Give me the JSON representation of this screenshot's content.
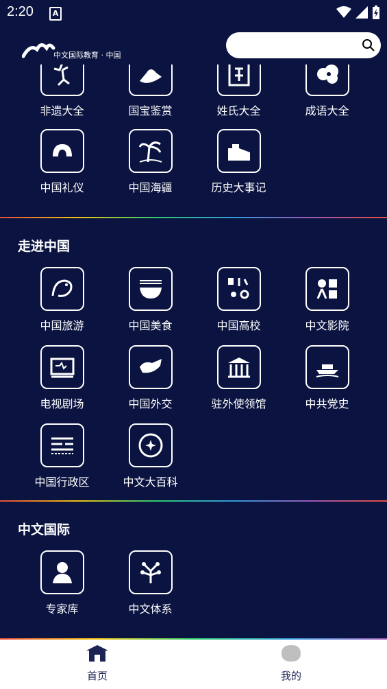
{
  "status": {
    "time": "2:20"
  },
  "header": {
    "logo_text": "中文国际教育 · 中国",
    "search_placeholder": ""
  },
  "section0": {
    "items": [
      {
        "label": "非遗大全",
        "icon": "dancer-icon"
      },
      {
        "label": "国宝鉴赏",
        "icon": "treasure-icon"
      },
      {
        "label": "姓氏大全",
        "icon": "surname-icon"
      },
      {
        "label": "成语大全",
        "icon": "cloud-icon"
      },
      {
        "label": "中国礼仪",
        "icon": "bow-icon"
      },
      {
        "label": "中国海疆",
        "icon": "palm-icon"
      },
      {
        "label": "历史大事记",
        "icon": "great-wall-icon"
      }
    ]
  },
  "section1": {
    "title": "走进中国",
    "items": [
      {
        "label": "中国旅游",
        "icon": "dragon-icon"
      },
      {
        "label": "中国美食",
        "icon": "bowl-icon"
      },
      {
        "label": "中国高校",
        "icon": "school-icon"
      },
      {
        "label": "中文影院",
        "icon": "cinema-icon"
      },
      {
        "label": "电视剧场",
        "icon": "tv-icon"
      },
      {
        "label": "中国外交",
        "icon": "handshake-icon"
      },
      {
        "label": "驻外使领馆",
        "icon": "embassy-icon"
      },
      {
        "label": "中共党史",
        "icon": "boat-icon"
      },
      {
        "label": "中国行政区",
        "icon": "map-icon"
      },
      {
        "label": "中文大百科",
        "icon": "encyclopedia-icon"
      }
    ]
  },
  "section2": {
    "title": "中文国际",
    "items": [
      {
        "label": "专家库",
        "icon": "expert-icon"
      },
      {
        "label": "中文体系",
        "icon": "system-icon"
      }
    ]
  },
  "bottom": {
    "tabs": [
      {
        "label": "首页",
        "icon": "home-icon"
      },
      {
        "label": "我的",
        "icon": "profile-icon"
      }
    ]
  }
}
